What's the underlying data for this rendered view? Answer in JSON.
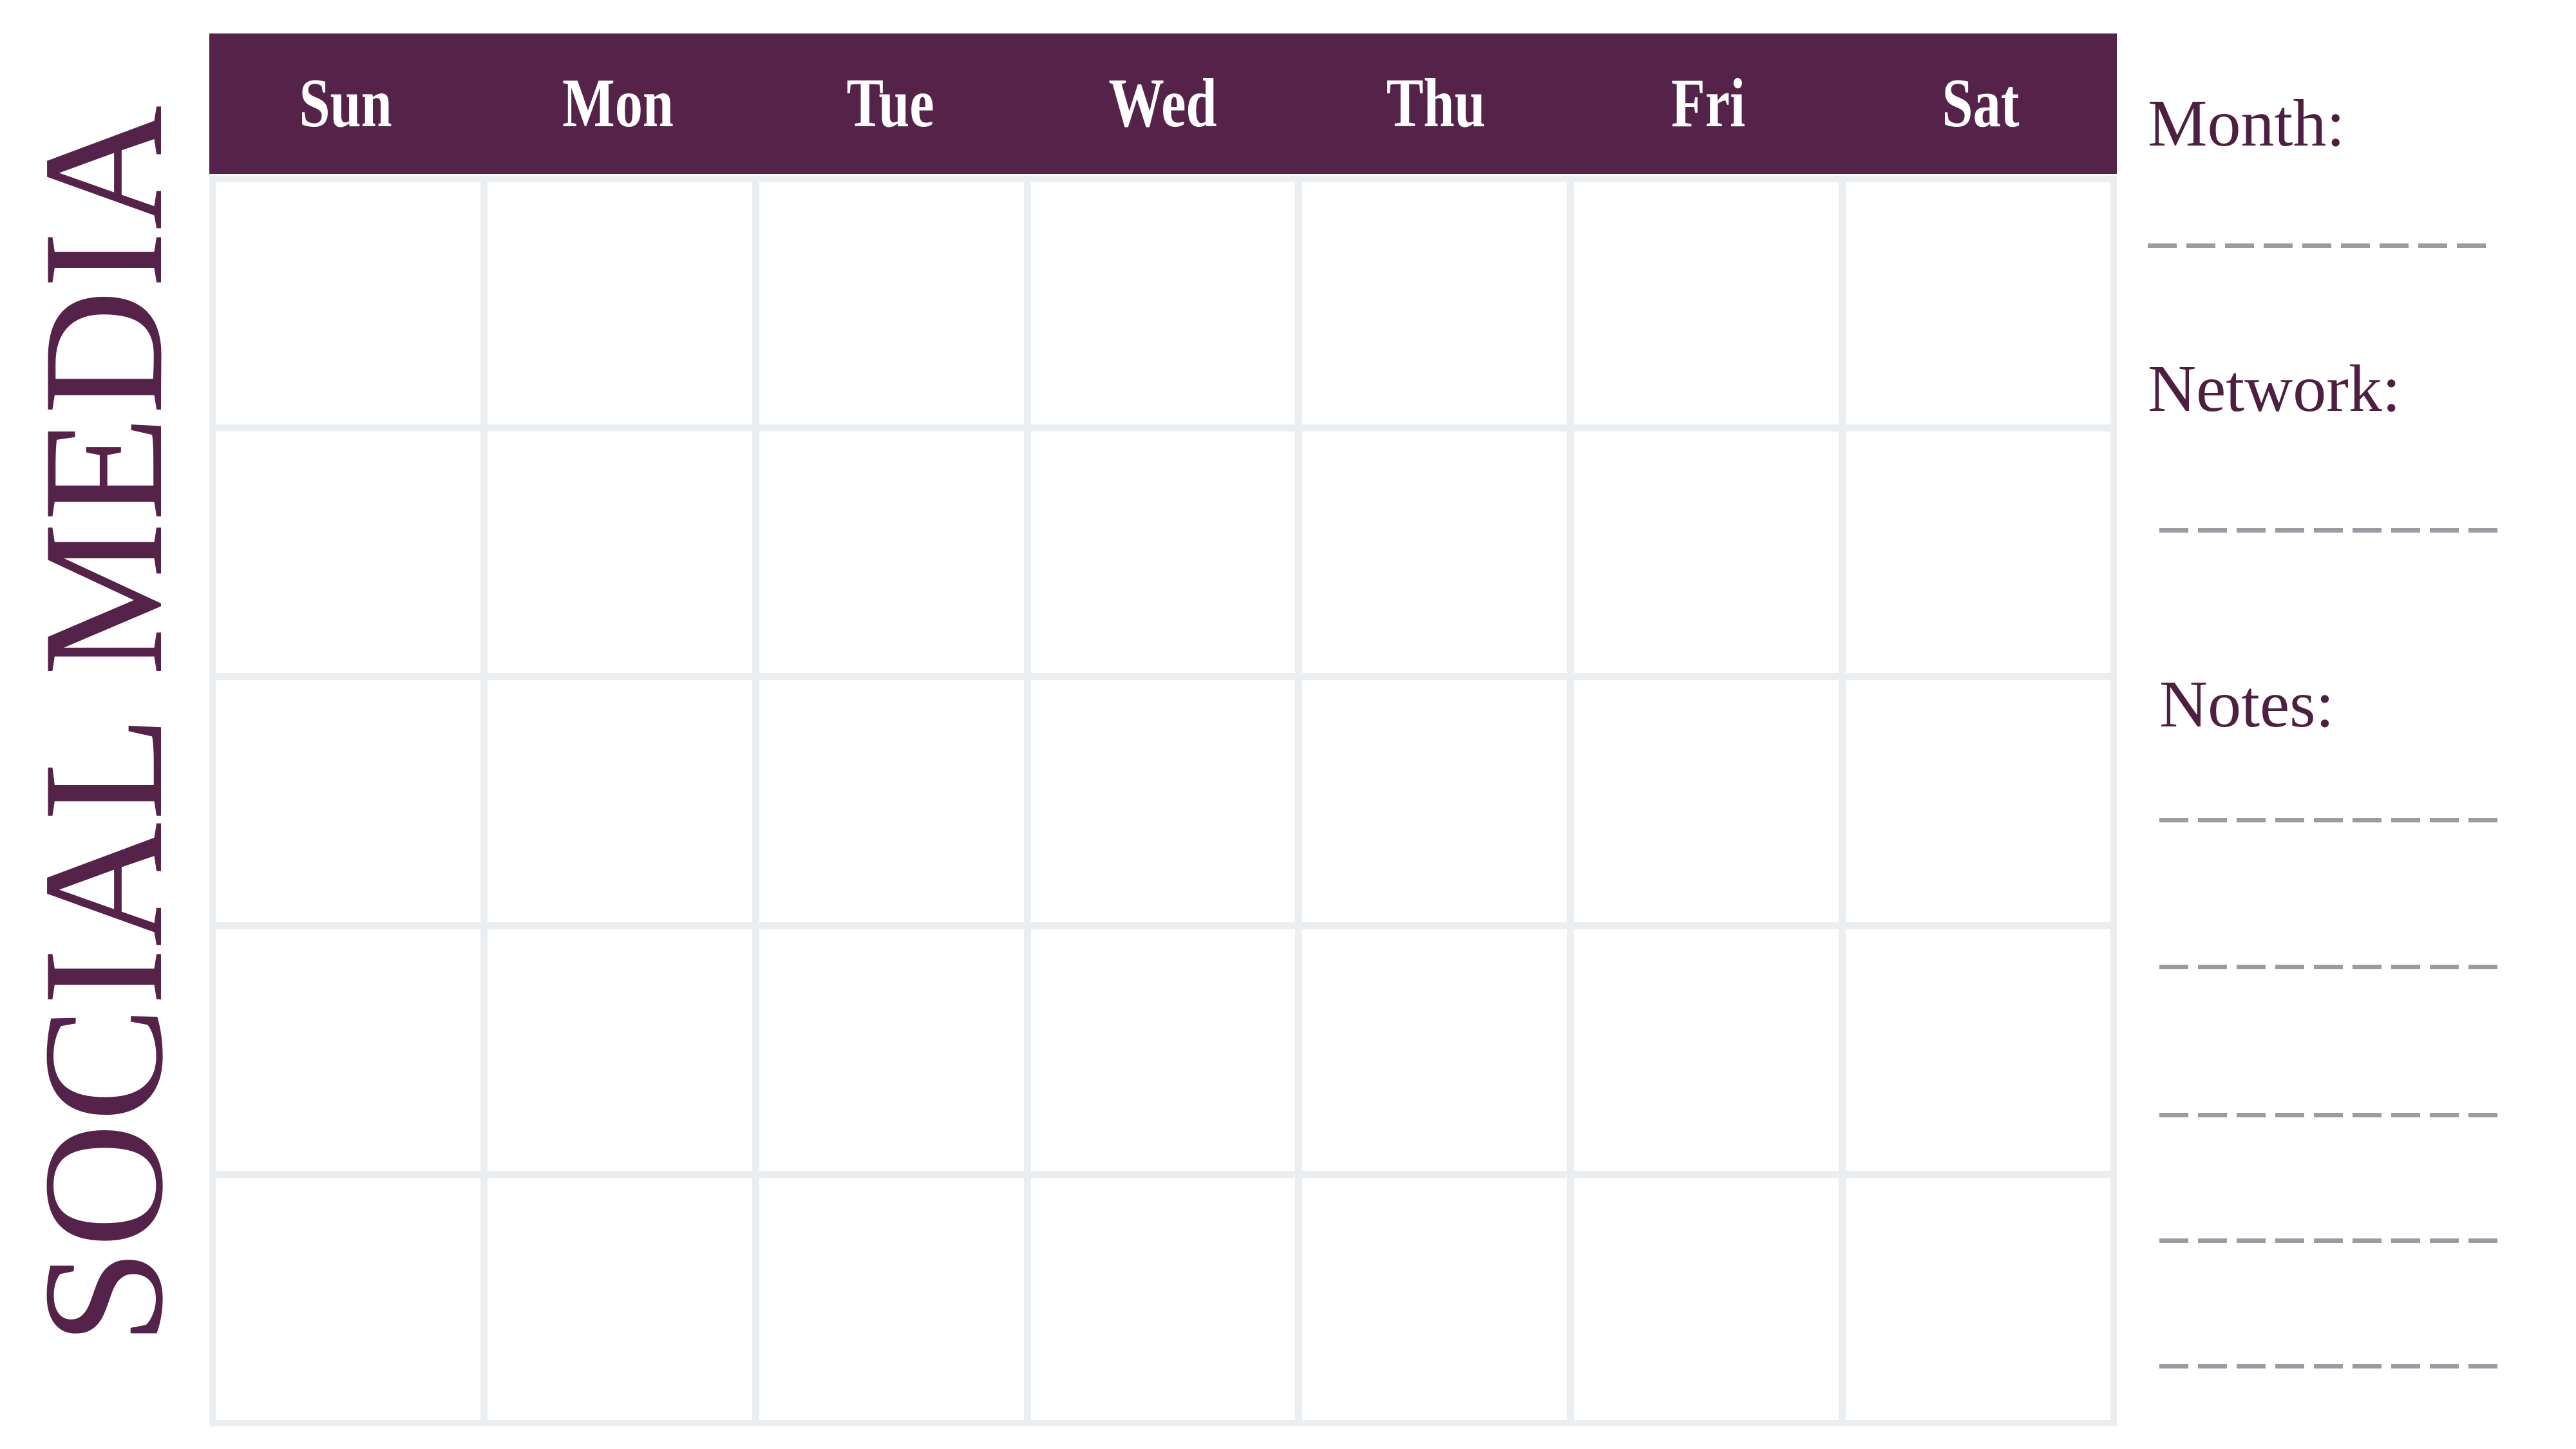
{
  "title": {
    "vertical_heading": "SOCIAL MEDIA"
  },
  "calendar": {
    "day_headers": [
      "Sun",
      "Mon",
      "Tue",
      "Wed",
      "Thu",
      "Fri",
      "Sat"
    ],
    "rows": 5,
    "columns": 7,
    "cells": [
      "",
      "",
      "",
      "",
      "",
      "",
      "",
      "",
      "",
      "",
      "",
      "",
      "",
      "",
      "",
      "",
      "",
      "",
      "",
      "",
      "",
      "",
      "",
      "",
      "",
      "",
      "",
      "",
      "",
      "",
      "",
      "",
      "",
      "",
      ""
    ]
  },
  "sidebar": {
    "month_label": "Month:",
    "network_label": "Network:",
    "notes_label": "Notes:",
    "month_lines": 1,
    "network_lines": 1,
    "notes_lines": 5
  },
  "colors": {
    "header_plum": "#552349",
    "text_plum": "#4d1f41",
    "grid_gap": "#eaeef1",
    "cell": "#ffffff",
    "dash_gray": "#9b9ba2",
    "page_background": "#ffffff"
  }
}
